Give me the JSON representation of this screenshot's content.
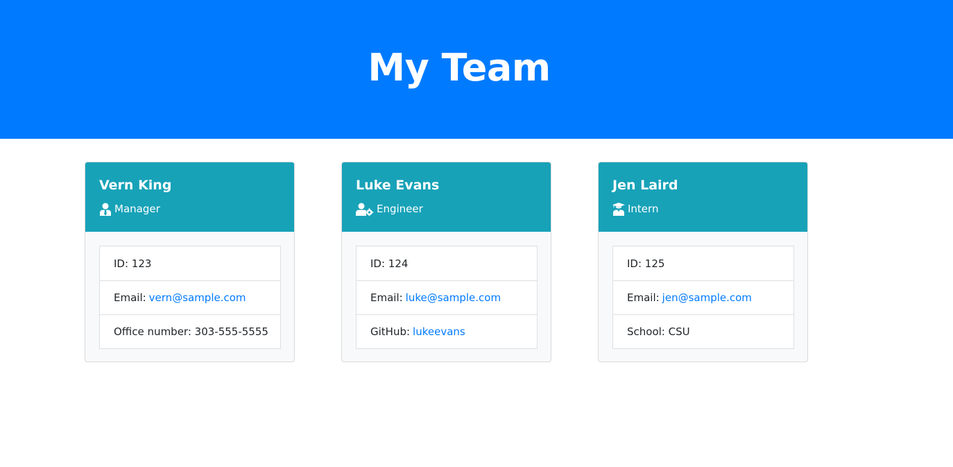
{
  "header": {
    "title": "My Team"
  },
  "colors": {
    "banner": "#007bff",
    "card_header": "#17a2b8",
    "link": "#007bff"
  },
  "cards": [
    {
      "name": "Vern King",
      "role": "Manager",
      "role_icon": "user-tie-icon",
      "id_line": "ID: 123",
      "email_label": "Email:",
      "email": "vern@sample.com",
      "extra_label": "Office number: 303-555-5555",
      "extra_link": ""
    },
    {
      "name": "Luke Evans",
      "role": "Engineer",
      "role_icon": "user-cog-icon",
      "id_line": "ID: 124",
      "email_label": "Email:",
      "email": "luke@sample.com",
      "extra_label": "GitHub:",
      "extra_link": "lukeevans"
    },
    {
      "name": "Jen Laird",
      "role": "Intern",
      "role_icon": "user-graduate-icon",
      "id_line": "ID: 125",
      "email_label": "Email:",
      "email": "jen@sample.com",
      "extra_label": "School: CSU",
      "extra_link": ""
    }
  ]
}
